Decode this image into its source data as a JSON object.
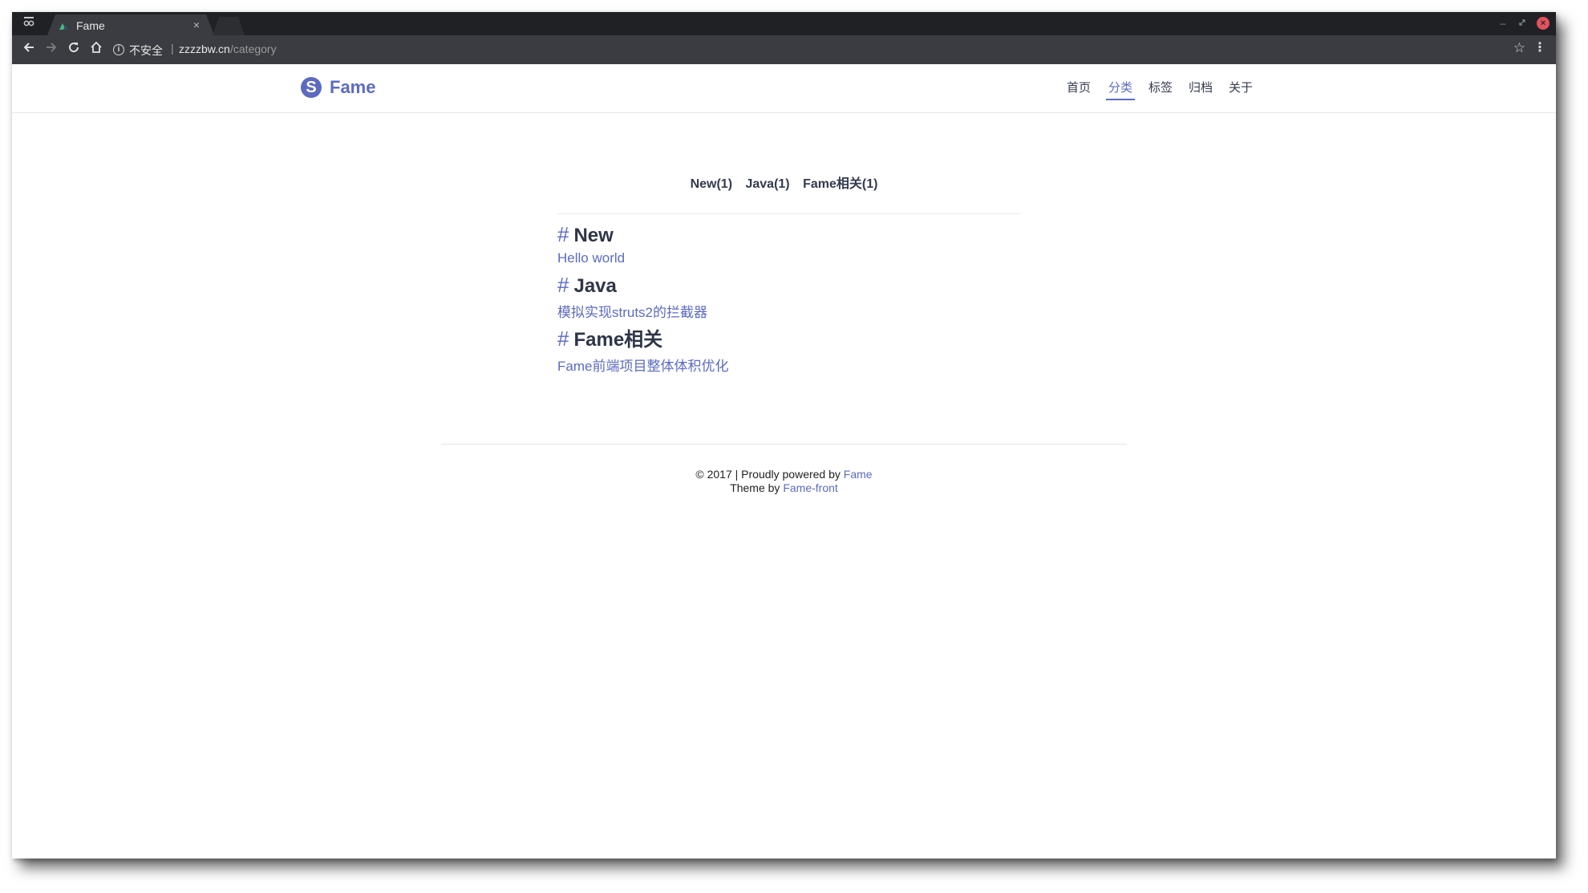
{
  "browser": {
    "tab_title": "Fame",
    "tab_close": "×",
    "insecure_label": "不安全",
    "url_separator": "|",
    "url_host": "zzzzbw.cn",
    "url_path": "/category"
  },
  "site": {
    "logo_text": "Fame",
    "nav": [
      "首页",
      "分类",
      "标签",
      "归档",
      "关于"
    ],
    "active_nav": "分类"
  },
  "categories": {
    "links": [
      "New(1)",
      "Java(1)",
      "Fame相关(1)"
    ],
    "sections": [
      {
        "hash": "#",
        "name": "New",
        "post": "Hello world"
      },
      {
        "hash": "#",
        "name": "Java",
        "post": "模拟实现struts2的拦截器"
      },
      {
        "hash": "#",
        "name": "Fame相关",
        "post": "Fame前端项目整体体积优化"
      }
    ]
  },
  "footer": {
    "copyright": "© 2017 | Proudly powered by",
    "powered_link": "Fame",
    "theme_prefix": "Theme by",
    "theme_link": "Fame-front"
  },
  "colors": {
    "accent": "#5c6bc0",
    "text": "#333b4e",
    "browser_frame": "#202124",
    "browser_toolbar": "#3b3c41"
  },
  "icons": [
    "tab-menu-icon",
    "favicon-icon",
    "back-icon",
    "forward-icon",
    "reload-icon",
    "home-icon",
    "info-icon",
    "star-icon",
    "menu-icon",
    "logo-icon"
  ]
}
